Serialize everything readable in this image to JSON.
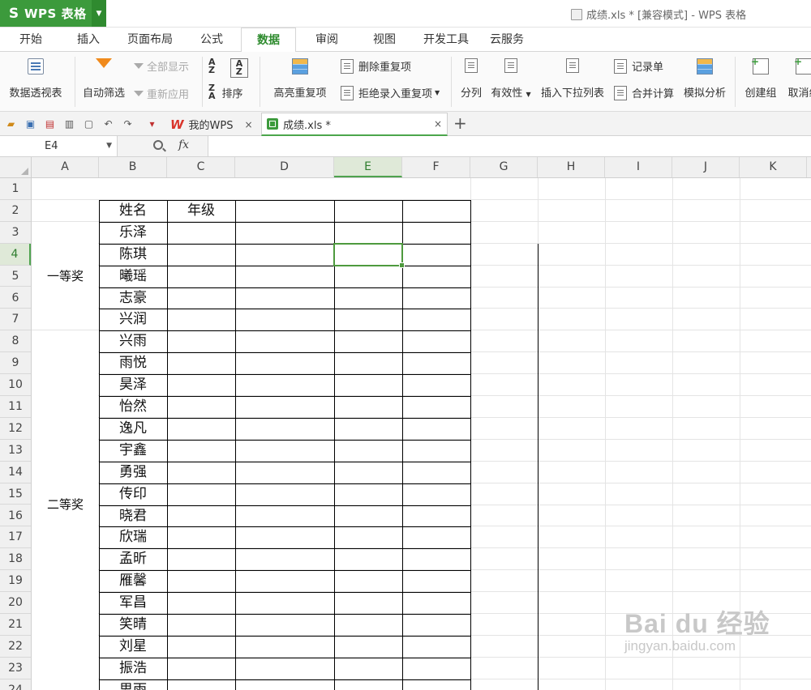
{
  "app": {
    "name": "WPS 表格",
    "logo_glyph": "S",
    "window_title": "成绩.xls * [兼容模式] - WPS 表格",
    "accent": "#3c9a3c"
  },
  "menu": {
    "tabs": [
      "开始",
      "插入",
      "页面布局",
      "公式",
      "数据",
      "审阅",
      "视图",
      "开发工具",
      "云服务"
    ],
    "active": "数据"
  },
  "ribbon": {
    "pivot": "数据透视表",
    "autofilter": "自动筛选",
    "show_all": "全部显示",
    "reapply": "重新应用",
    "sort": "排序",
    "highlight_dup": "高亮重复项",
    "delete_dup": "删除重复项",
    "reject_dup": "拒绝录入重复项",
    "split": "分列",
    "validity": "有效性",
    "insert_dropdown": "插入下拉列表",
    "record": "记录单",
    "consolidate": "合并计算",
    "whatif": "模拟分析",
    "create_group": "创建组",
    "ungroup": "取消组"
  },
  "doc_tabs": [
    {
      "label": "我的WPS",
      "close": "×"
    },
    {
      "label": "成绩.xls *",
      "close": "×"
    }
  ],
  "new_tab": "+",
  "formula": {
    "cell_ref": "E4",
    "fx": "fx",
    "value": ""
  },
  "sheet": {
    "columns": [
      "A",
      "B",
      "C",
      "D",
      "E",
      "F",
      "G",
      "H",
      "I",
      "J",
      "K"
    ],
    "rows": [
      "1",
      "2",
      "3",
      "4",
      "5",
      "6",
      "7",
      "8",
      "9",
      "10",
      "11",
      "12",
      "13",
      "14",
      "15",
      "16",
      "17",
      "18",
      "19",
      "20",
      "21",
      "22",
      "23",
      "24"
    ],
    "selected_col": "E",
    "selected_row": "4",
    "header_name": "姓名",
    "header_grade": "年级",
    "names": [
      "乐泽",
      "陈琪",
      "曦瑶",
      "志豪",
      "兴润",
      "兴雨",
      "雨悦",
      "昊泽",
      "怡然",
      "逸凡",
      "宇鑫",
      "勇强",
      "传印",
      "晓君",
      "欣瑞",
      "孟昕",
      "雁馨",
      "军昌",
      "笑晴",
      "刘星",
      "振浩",
      "思雨"
    ],
    "prize_first": "一等奖",
    "prize_second": "二等奖"
  },
  "watermark": {
    "main": "Bai du 经验",
    "sub": "jingyan.baidu.com"
  }
}
